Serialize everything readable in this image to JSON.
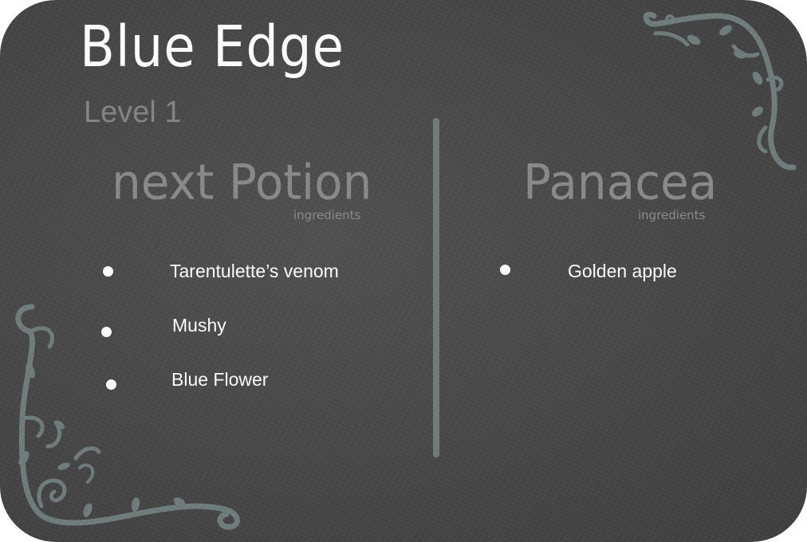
{
  "game": {
    "title": "Blue Edge",
    "level": "Level 1"
  },
  "left_panel": {
    "heading": "next Potion",
    "subheading": "ingredients",
    "ingredients": [
      "Tarentulette’s venom",
      "Mushy",
      "Blue Flower"
    ]
  },
  "right_panel": {
    "heading": "Panacea",
    "subheading": "ingredients",
    "ingredients": [
      "Golden apple"
    ]
  },
  "colors": {
    "background": "#474747",
    "title": "#ffffff",
    "headings": "#8a8a8a",
    "ornament": "#6f7c7c",
    "text": "#ffffff"
  }
}
